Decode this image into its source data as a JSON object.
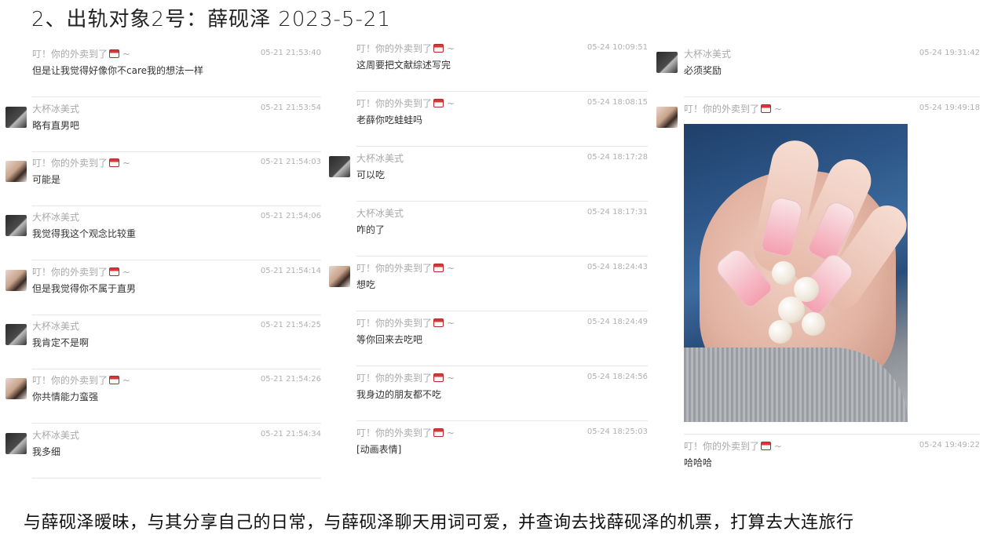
{
  "title": "2、出轨对象2号：薛砚泽 2023-5-21",
  "caption": "与薛砚泽暧昧，与其分享自己的日常，与薛砚泽聊天用词可爱，并查询去找薛砚泽的机票，打算去大连旅行",
  "colors": {
    "muted": "#a8a8a8",
    "divider": "#e6e6e6",
    "text": "#333333"
  },
  "column1": {
    "messages": [
      {
        "sender": "叮！你的外卖到了",
        "emoji": "takeout-bag-icon",
        "tilde": "~",
        "time": "05-21 21:53:40",
        "text": "但是让我觉得好像你不care我的想法一样",
        "avatar": "none"
      },
      {
        "sender": "大杯冰美式",
        "time": "05-21 21:53:54",
        "text": "略有直男吧",
        "avatar": "dark"
      },
      {
        "sender": "叮！你的外卖到了",
        "emoji": "takeout-bag-icon",
        "tilde": "~",
        "time": "05-21 21:54:03",
        "text": "可能是",
        "avatar": "light"
      },
      {
        "sender": "大杯冰美式",
        "time": "05-21 21:54:06",
        "text": "我觉得我这个观念比较重",
        "avatar": "dark"
      },
      {
        "sender": "叮！你的外卖到了",
        "emoji": "takeout-bag-icon",
        "tilde": "~",
        "time": "05-21 21:54:14",
        "text": "但是我觉得你不属于直男",
        "avatar": "light"
      },
      {
        "sender": "大杯冰美式",
        "time": "05-21 21:54:25",
        "text": "我肯定不是啊",
        "avatar": "dark"
      },
      {
        "sender": "叮！你的外卖到了",
        "emoji": "takeout-bag-icon",
        "tilde": "~",
        "time": "05-21 21:54:26",
        "text": "你共情能力蛮强",
        "avatar": "light"
      },
      {
        "sender": "大杯冰美式",
        "time": "05-21 21:54:34",
        "text": "我多细",
        "avatar": "dark"
      }
    ]
  },
  "column2": {
    "messages": [
      {
        "sender": "叮！你的外卖到了",
        "emoji": "takeout-bag-icon",
        "tilde": "~",
        "time": "05-24 10:09:51",
        "text": "这周要把文献综述写完",
        "avatar": "none"
      },
      {
        "sender": "叮！你的外卖到了",
        "emoji": "takeout-bag-icon",
        "tilde": "~",
        "time": "05-24 18:08:15",
        "text": "老薛你吃蛙蛙吗",
        "avatar": "none"
      },
      {
        "sender": "大杯冰美式",
        "time": "05-24 18:17:28",
        "text": "可以吃",
        "avatar": "dark"
      },
      {
        "sender": "大杯冰美式",
        "time": "05-24 18:17:31",
        "text": "咋的了",
        "avatar": "none"
      },
      {
        "sender": "叮！你的外卖到了",
        "emoji": "takeout-bag-icon",
        "tilde": "~",
        "time": "05-24 18:24:43",
        "text": "想吃",
        "avatar": "light"
      },
      {
        "sender": "叮！你的外卖到了",
        "emoji": "takeout-bag-icon",
        "tilde": "~",
        "time": "05-24 18:24:49",
        "text": "等你回来去吃吧",
        "avatar": "none"
      },
      {
        "sender": "叮！你的外卖到了",
        "emoji": "takeout-bag-icon",
        "tilde": "~",
        "time": "05-24 18:24:56",
        "text": "我身边的朋友都不吃",
        "avatar": "none"
      },
      {
        "sender": "叮！你的外卖到了",
        "emoji": "takeout-bag-icon",
        "tilde": "~",
        "time": "05-24 18:25:03",
        "text": "[动画表情]",
        "avatar": "none"
      }
    ]
  },
  "column3": {
    "messages": [
      {
        "sender": "大杯冰美式",
        "time": "05-24 19:31:42",
        "text": "必须奖励",
        "avatar": "dark"
      },
      {
        "sender": "叮！你的外卖到了",
        "emoji": "takeout-bag-icon",
        "tilde": "~",
        "time": "05-24 19:49:18",
        "text": "",
        "avatar": "light",
        "image": "nail-photo"
      },
      {
        "sender": "叮！你的外卖到了",
        "emoji": "takeout-bag-icon",
        "tilde": "~",
        "time": "05-24 19:49:22",
        "text": "哈哈哈",
        "avatar": "none"
      }
    ]
  }
}
